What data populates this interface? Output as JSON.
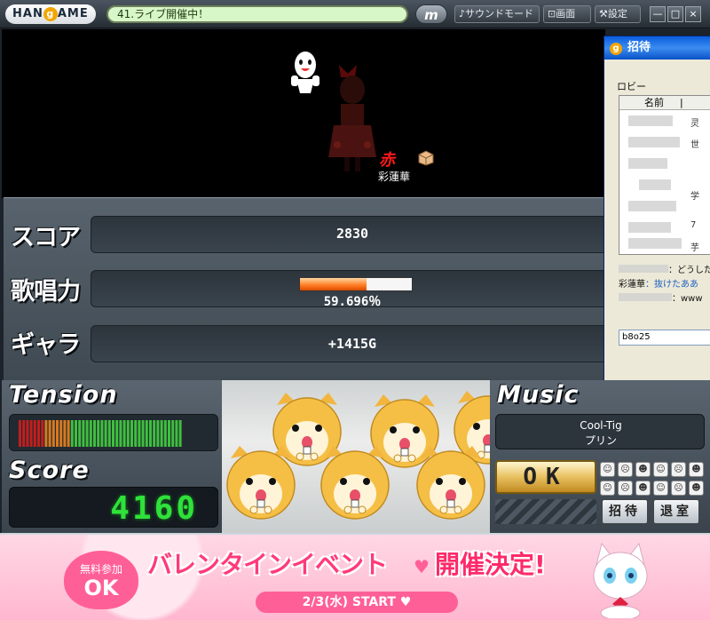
{
  "topbar": {
    "logo": "HAN",
    "logo_g": "g",
    "logo_tail": "AME",
    "ticker": "41.ライブ開催中！",
    "m_button": "m",
    "sound_mode": "♪サウンドモード",
    "screen": "画面",
    "settings": "設定",
    "minimize": "—",
    "maximize": "□",
    "close": "×"
  },
  "stage": {
    "red_mark": "赤",
    "player_name": "彩蓮華"
  },
  "stats": {
    "score_label": "スコア",
    "score_value": "2830",
    "power_label": "歌唱力",
    "power_percent_text": "59.696％",
    "power_fraction": 0.59696,
    "gala_label": "ギャラ",
    "gala_value": "+1415G"
  },
  "invite": {
    "title": "招待",
    "title_g": "g",
    "lobby": "ロビー",
    "name_header": "名前",
    "side_chars": [
      "灵",
      "世",
      "学",
      "7",
      "芋"
    ],
    "chat": [
      {
        "speaker": "",
        "text": "：どうした"
      },
      {
        "speaker": "彩蓮華",
        "text": "：抜けたああ"
      },
      {
        "speaker": "",
        "text": "：www"
      }
    ],
    "input_value": "b8o25"
  },
  "tension": {
    "title": "Tension",
    "colors": {
      "red": "#c21e1e",
      "orange": "#d87a20",
      "green": "#3fbf3f"
    },
    "level": 1.0
  },
  "score_panel": {
    "title": "Score",
    "value": "4160"
  },
  "music": {
    "title": "Music",
    "song_title": "Cool-Tig",
    "song_artist": "プリン",
    "ok_label": "OK",
    "invite_label": "招待",
    "leave_label": "退室"
  },
  "banner": {
    "badge_small": "無料参加",
    "badge_ok": "OK",
    "headline_1": "バレンタインイベント",
    "headline_2": "開催決定!",
    "date": "2/3(水) START ♥"
  }
}
